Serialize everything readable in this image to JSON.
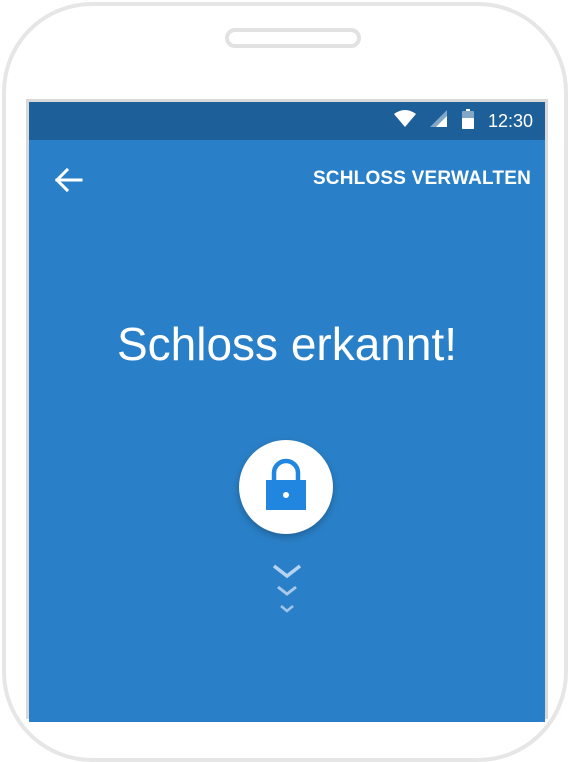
{
  "status_bar": {
    "time": "12:30",
    "icons": [
      "wifi-icon",
      "signal-icon",
      "battery-icon"
    ]
  },
  "app_bar": {
    "back_icon": "arrow-left-icon",
    "action_label": "SCHLOSS VERWALTEN"
  },
  "main": {
    "title": "Schloss erkannt!",
    "lock_icon": "lock-icon",
    "indicator_icon": "chevrons-down-icon"
  },
  "colors": {
    "screen_bg": "#2a80c8",
    "status_bar_bg": "#1d5f99",
    "accent": "#2186e0",
    "text": "#ffffff"
  }
}
